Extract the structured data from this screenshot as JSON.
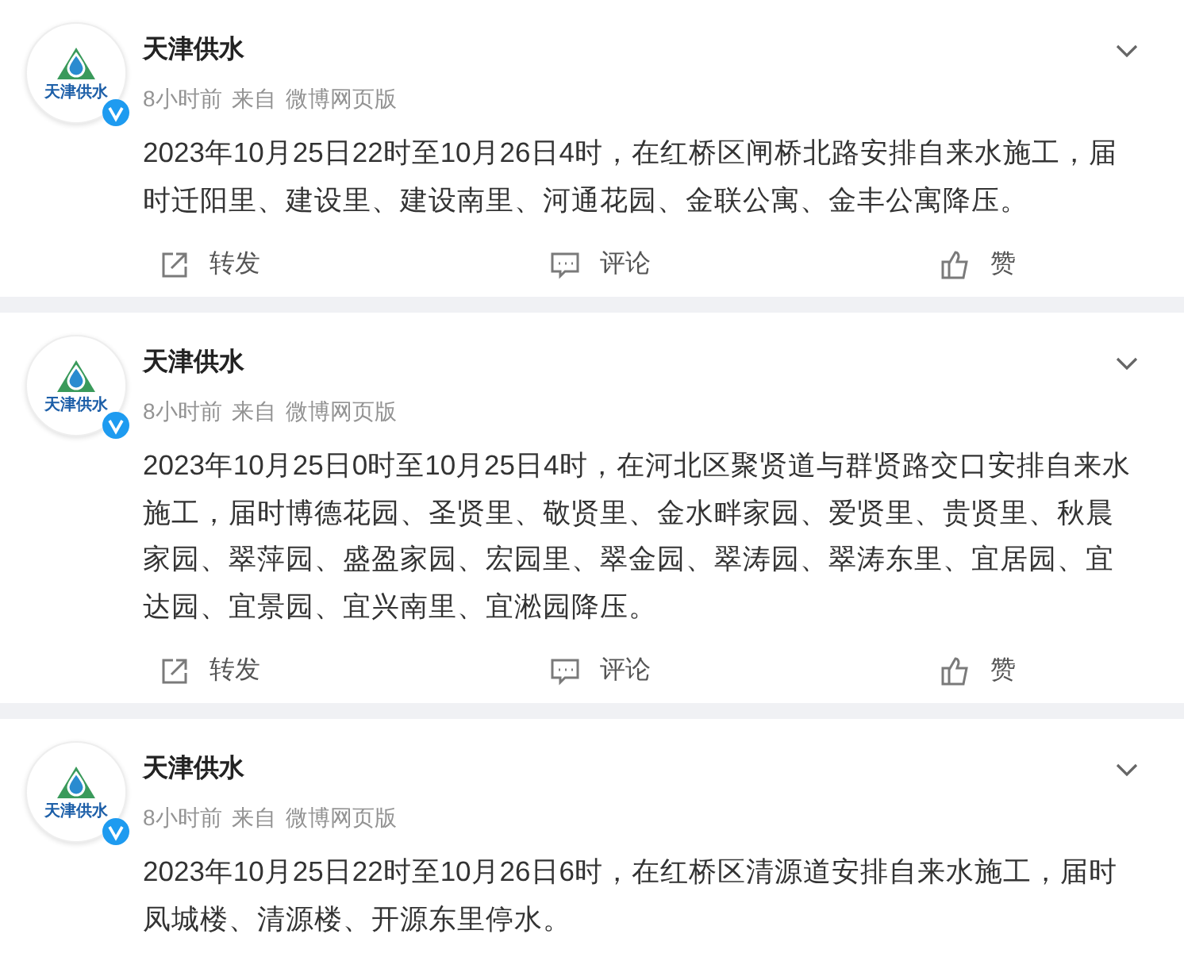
{
  "posts": [
    {
      "account": {
        "name": "天津供水",
        "avatar_text": "天津供水",
        "verified": true
      },
      "time": "8小时前",
      "source_prefix": "来自",
      "source": "微博网页版",
      "text": "2023年10月25日22时至10月26日4时，在红桥区闸桥北路安排自来水施工，届时迁阳里、建设里、建设南里、河通花园、金联公寓、金丰公寓降压。",
      "actions": [
        {
          "kind": "repost",
          "label": "转发"
        },
        {
          "kind": "comment",
          "label": "评论"
        },
        {
          "kind": "like",
          "label": "赞"
        }
      ]
    },
    {
      "account": {
        "name": "天津供水",
        "avatar_text": "天津供水",
        "verified": true
      },
      "time": "8小时前",
      "source_prefix": "来自",
      "source": "微博网页版",
      "text": "2023年10月25日0时至10月25日4时，在河北区聚贤道与群贤路交口安排自来水施工，届时博德花园、圣贤里、敬贤里、金水畔家园、爱贤里、贵贤里、秋晨家园、翠萍园、盛盈家园、宏园里、翠金园、翠涛园、翠涛东里、宜居园、宜达园、宜景园、宜兴南里、宜淞园降压。",
      "actions": [
        {
          "kind": "repost",
          "label": "转发"
        },
        {
          "kind": "comment",
          "label": "评论"
        },
        {
          "kind": "like",
          "label": "赞"
        }
      ]
    },
    {
      "account": {
        "name": "天津供水",
        "avatar_text": "天津供水",
        "verified": true
      },
      "time": "8小时前",
      "source_prefix": "来自",
      "source": "微博网页版",
      "text": "2023年10月25日22时至10月26日6时，在红桥区清源道安排自来水施工，届时凤城楼、清源楼、开源东里停水。"
    }
  ]
}
